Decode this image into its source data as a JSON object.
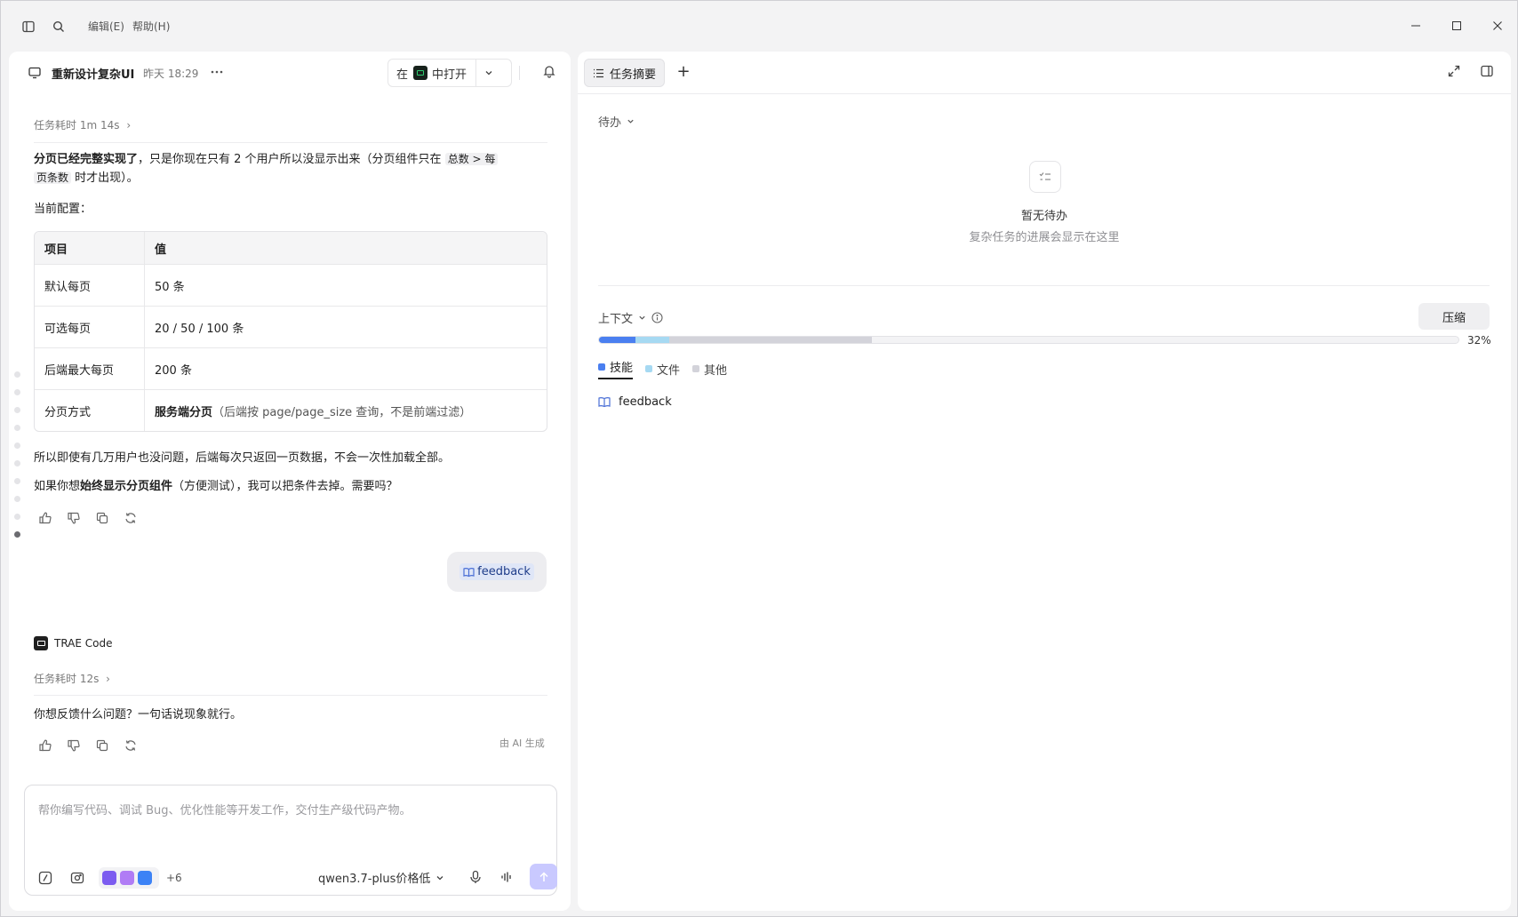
{
  "titlebar": {
    "menu_edit": "编辑(E)",
    "menu_help": "帮助(H)"
  },
  "chat": {
    "title": "重新设计复杂UI",
    "time": "昨天 18:29",
    "open_in_prefix": "在",
    "open_in_suffix": "中打开"
  },
  "message1": {
    "duration": "任务耗时 1m 14s",
    "p1_bold": "分页已经完整实现了",
    "p1_rest": "，只是你现在只有 2 个用户所以没显示出来（分页组件只在",
    "p1_code1": "总数 > 每",
    "p1_code2": "页条数",
    "p1_end": "时才出现）。",
    "config_label": "当前配置：",
    "table": {
      "headers": [
        "项目",
        "值"
      ],
      "rows": [
        {
          "key": "默认每页",
          "value": "50 条"
        },
        {
          "key": "可选每页",
          "value": "20 / 50 / 100 条"
        },
        {
          "key": "后端最大每页",
          "value": "200 条"
        },
        {
          "key": "分页方式",
          "value_bold": "服务端分页",
          "value_rest": "（后端按 page/page_size 查询，不是前端过滤）"
        }
      ]
    },
    "p2": "所以即使有几万用户也没问题，后端每次只返回一页数据，不会一次性加载全部。",
    "p3_pre": "如果你想",
    "p3_bold": "始终显示分页组件",
    "p3_rest": "（方便测试），我可以把条件去掉。需要吗？"
  },
  "user_message": {
    "chip_label": "feedback"
  },
  "message2": {
    "bot_name": "TRAE Code",
    "duration": "任务耗时 12s",
    "text": "你想反馈什么问题？一句话说现象就行。",
    "ai_generated": "由 AI 生成"
  },
  "input": {
    "placeholder": "帮你编写代码、调试 Bug、优化性能等开发工作，交付生产级代码产物。",
    "more_skills": "+6",
    "model": "qwen3.7-plus价格低"
  },
  "right": {
    "tab_label": "任务摘要",
    "todo_label": "待办",
    "empty_title": "暂无待办",
    "empty_sub": "复杂任务的进展会显示在这里",
    "context_label": "上下文",
    "compress_label": "压缩",
    "usage_percent": "32%",
    "usage_segments": [
      {
        "name": "技能",
        "fraction": 0.042,
        "color": "#4a7ff0"
      },
      {
        "name": "文件",
        "fraction": 0.04,
        "color": "#a6d9f2"
      },
      {
        "name": "其他",
        "fraction": 0.235,
        "color": "#d3d3da"
      }
    ],
    "legend": [
      {
        "label": "技能",
        "color": "#4a7ff0"
      },
      {
        "label": "文件",
        "color": "#a6d9f2"
      },
      {
        "label": "其他",
        "color": "#d3d3da"
      }
    ],
    "item_label": "feedback"
  }
}
